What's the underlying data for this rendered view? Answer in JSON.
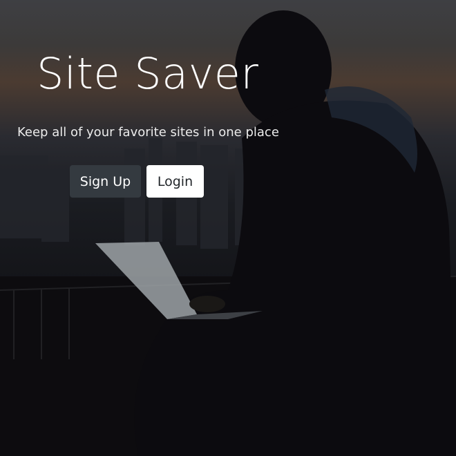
{
  "hero": {
    "title": "Site Saver",
    "tagline": "Keep all of your favorite sites in one place"
  },
  "actions": {
    "signup_label": "Sign Up",
    "login_label": "Login"
  },
  "colors": {
    "signup_bg": "#343a40",
    "login_bg": "#ffffff",
    "text_light": "#ffffff"
  }
}
